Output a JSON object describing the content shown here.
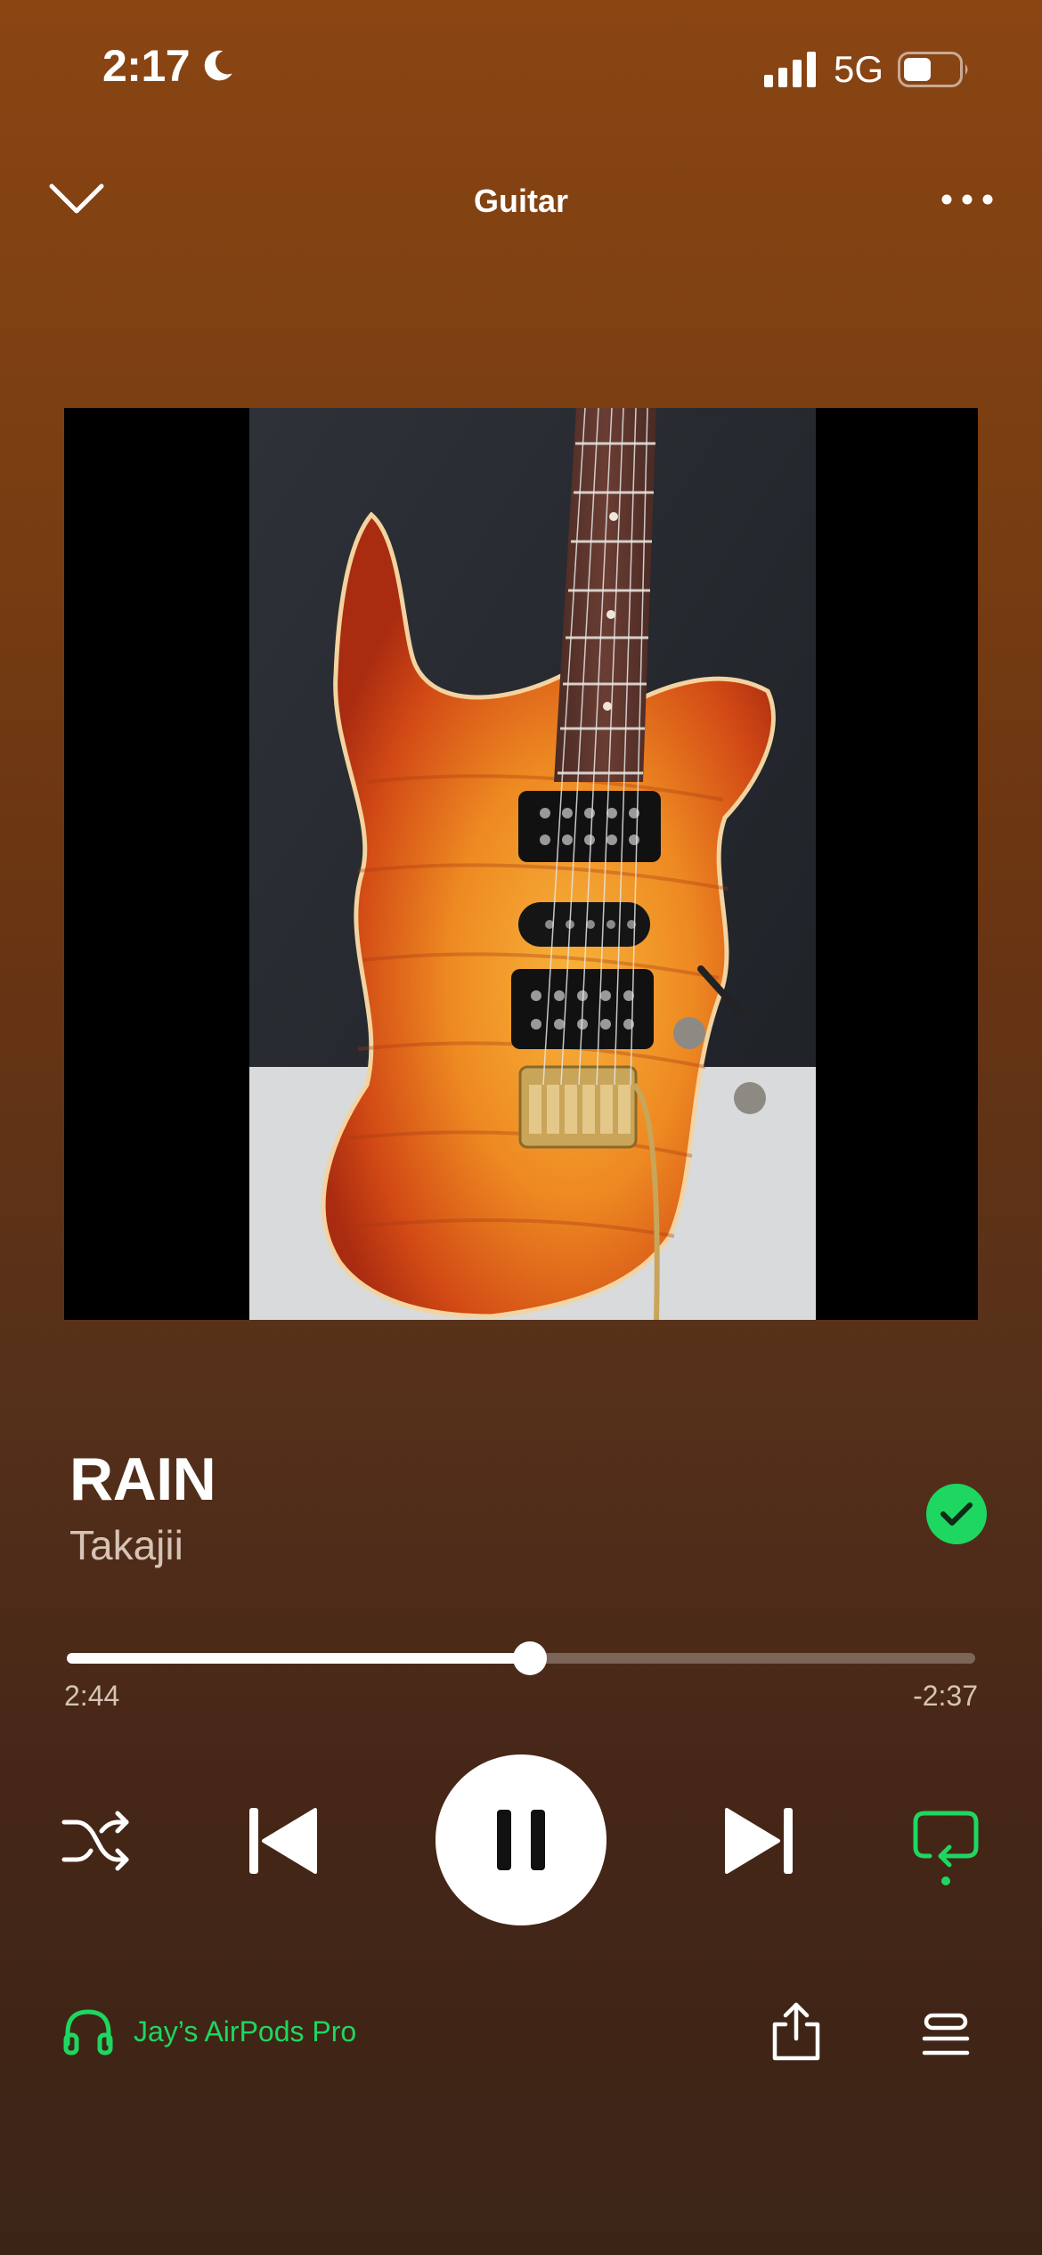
{
  "status_bar": {
    "time": "2:17",
    "network": "5G",
    "focus_icon": "moon-icon",
    "battery_level": 0.5
  },
  "header": {
    "title": "Guitar",
    "collapse_icon": "chevron-down-icon",
    "more_icon": "more-icon"
  },
  "track": {
    "title": "RAIN",
    "artist": "Takajii",
    "liked": true
  },
  "playback": {
    "elapsed": "2:44",
    "remaining": "-2:37",
    "progress": 0.51,
    "state": "playing",
    "shuffle": false,
    "repeat": true
  },
  "device": {
    "label": "Jay’s AirPods Pro",
    "icon": "headphones-icon"
  },
  "colors": {
    "accent": "#1ed760",
    "background_top": "#8a4513",
    "background_bottom": "#3b2416"
  }
}
